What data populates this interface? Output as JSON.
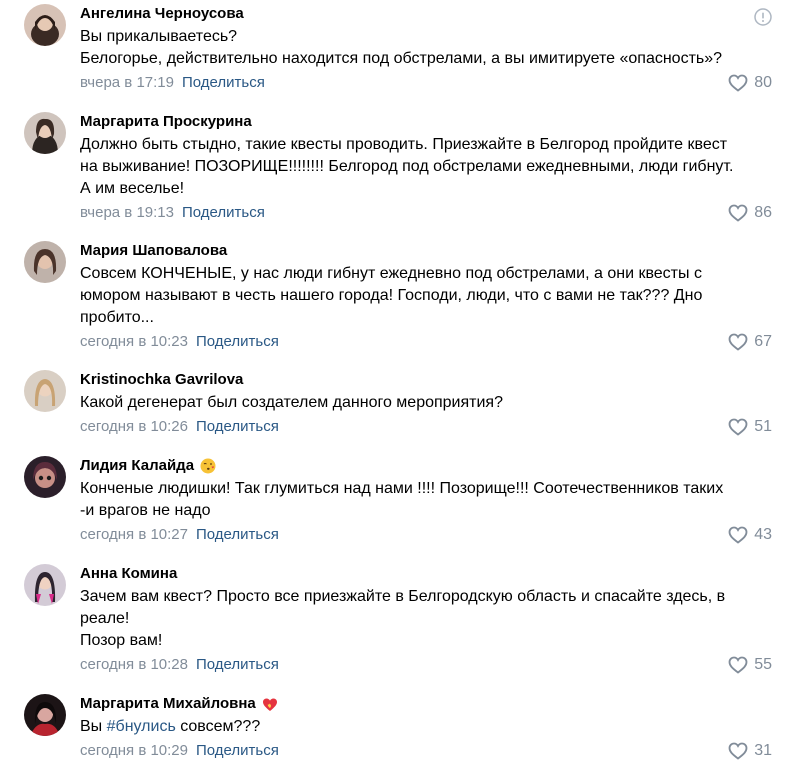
{
  "share_label": "Поделиться",
  "comments": [
    {
      "author": "Ангелина Черноусова",
      "lines": [
        "Вы прикалываетесь?",
        "Белогорье, действительно находится под обстрелами, а вы имитируете «опасность»?"
      ],
      "time": "вчера в 17:19",
      "likes": "80"
    },
    {
      "author": "Маргарита Проскурина",
      "lines": [
        "Должно быть стыдно, такие квесты проводить. Приезжайте в Белгород пройдите квест",
        "на выживание! ПОЗОРИЩЕ!!!!!!!! Белгород под обстрелами ежедневными, люди гибнут.",
        "А им веселье!"
      ],
      "time": "вчера в 19:13",
      "likes": "86"
    },
    {
      "author": "Мария Шаповалова",
      "lines": [
        "Совсем КОНЧЕНЫЕ, у нас люди гибнут ежедневно под обстрелами, а они квесты с",
        "юмором называют в честь нашего города! Господи, люди, что с вами не так??? Дно",
        "пробито..."
      ],
      "time": "сегодня в 10:23",
      "likes": "67"
    },
    {
      "author": "Kristinochka Gavrilova",
      "lines": [
        "Какой дегенерат был создателем данного мероприятия?"
      ],
      "time": "сегодня в 10:26",
      "likes": "51"
    },
    {
      "author": "Лидия Калайда",
      "lines": [
        "Конченые людишки! Так глумиться над нами !!!! Позорище!!! Соотечественников таких",
        "-и врагов не надо"
      ],
      "time": "сегодня в 10:27",
      "likes": "43"
    },
    {
      "author": "Анна Комина",
      "lines": [
        "Зачем вам квест? Просто все приезжайте в Белгородскую область и спасайте здесь, в",
        "реале!",
        "Позор вам!"
      ],
      "time": "сегодня в 10:28",
      "likes": "55"
    },
    {
      "author": "Маргарита Михайловна",
      "text_prefix": "Вы ",
      "hashtag": "#бнулись",
      "text_suffix": " совсем???",
      "time": "сегодня в 10:29",
      "likes": "31"
    }
  ],
  "colors": {
    "meta": "#818c99",
    "link": "#2a5885"
  }
}
